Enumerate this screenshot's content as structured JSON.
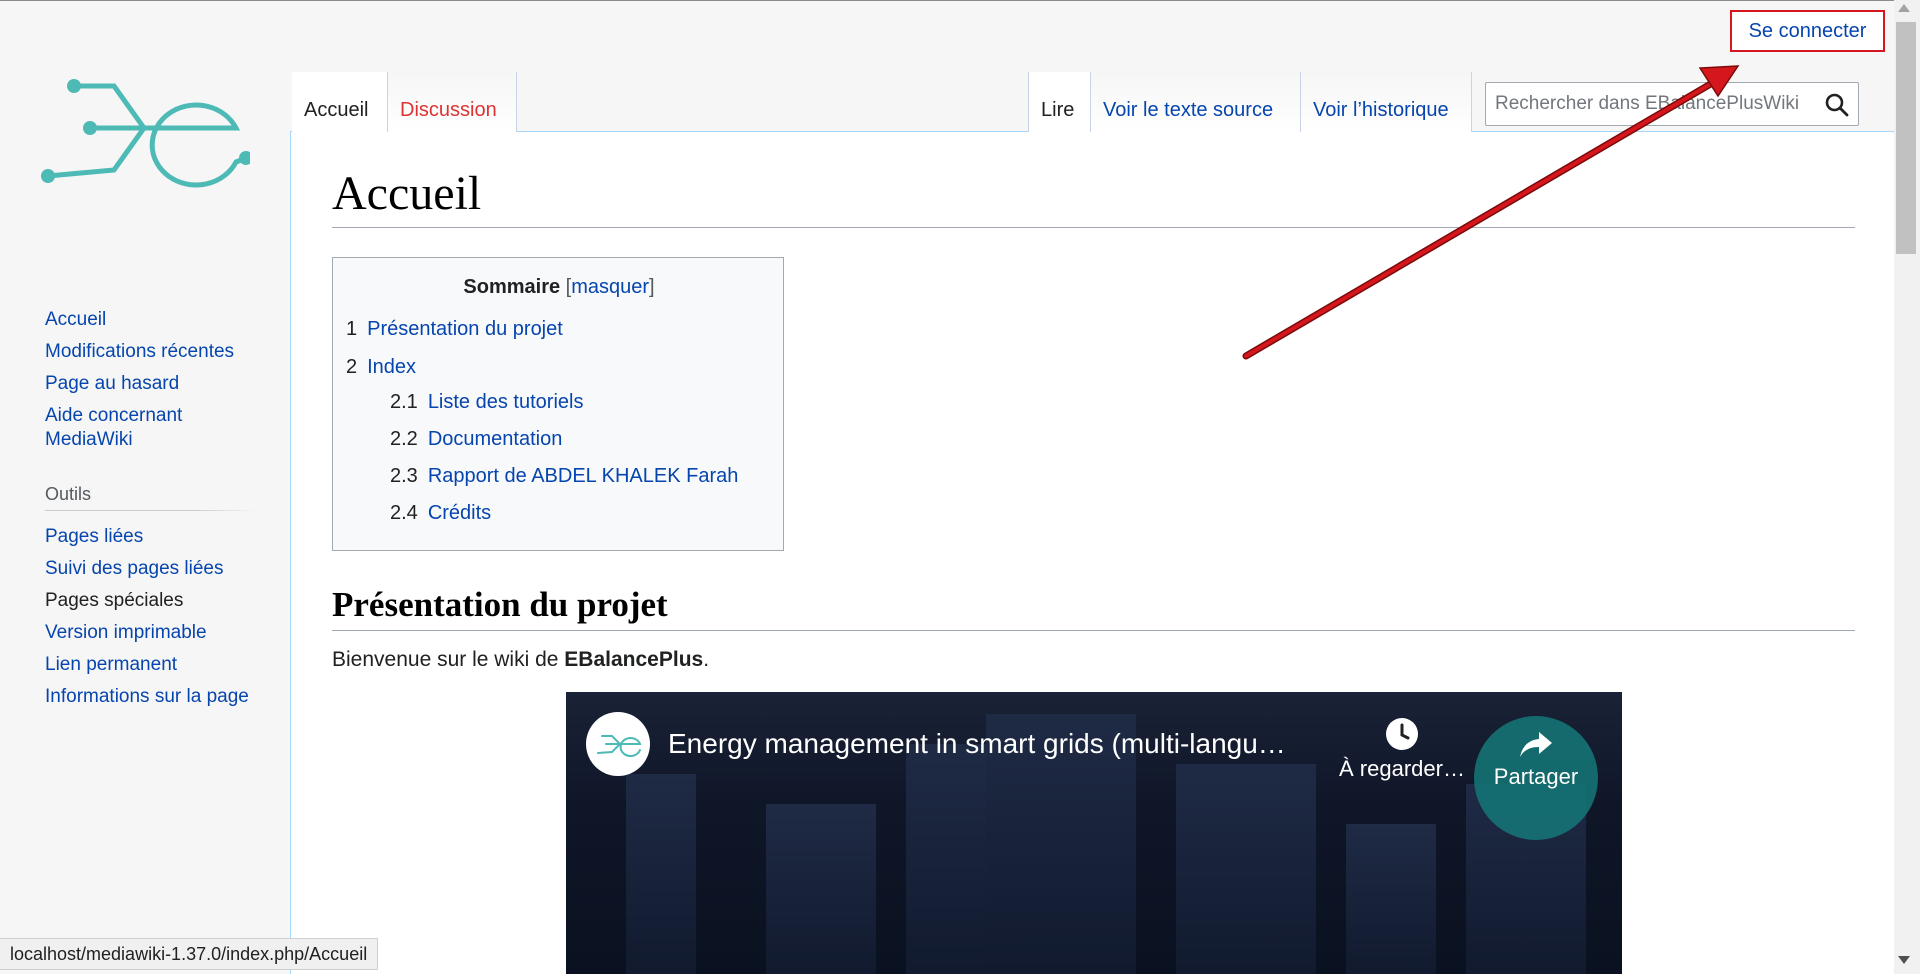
{
  "personal": {
    "login_label": "Se connecter"
  },
  "tabs": {
    "left": [
      {
        "label": "Accueil",
        "selected": true
      },
      {
        "label": "Discussion",
        "selected": false,
        "new": true
      }
    ],
    "right": [
      {
        "label": "Lire",
        "selected": true
      },
      {
        "label": "Voir le texte source",
        "selected": false
      },
      {
        "label": "Voir l’historique",
        "selected": false
      }
    ]
  },
  "search": {
    "placeholder": "Rechercher dans EBalancePlusWiki",
    "icon": "search-icon"
  },
  "sidebar": {
    "nav": [
      {
        "label": "Accueil"
      },
      {
        "label": "Modifications récentes"
      },
      {
        "label": "Page au hasard"
      },
      {
        "label": "Aide concernant MediaWiki"
      }
    ],
    "tools_heading": "Outils",
    "tools": [
      {
        "label": "Pages liées"
      },
      {
        "label": "Suivi des pages liées"
      },
      {
        "label": "Pages spéciales"
      },
      {
        "label": "Version imprimable"
      },
      {
        "label": "Lien permanent"
      },
      {
        "label": "Informations sur la page"
      }
    ]
  },
  "page": {
    "title": "Accueil",
    "toc": {
      "title": "Sommaire",
      "toggle_open": "[",
      "toggle_label": "masquer",
      "toggle_close": "]",
      "items": [
        {
          "num": "1",
          "label": "Présentation du projet"
        },
        {
          "num": "2",
          "label": "Index"
        },
        {
          "num": "2.1",
          "label": "Liste des tutoriels"
        },
        {
          "num": "2.2",
          "label": "Documentation"
        },
        {
          "num": "2.3",
          "label": "Rapport de ABDEL KHALEK Farah"
        },
        {
          "num": "2.4",
          "label": "Crédits"
        }
      ]
    },
    "section_heading": "Présentation du projet",
    "welcome_text": "Bienvenue sur le wiki de ",
    "welcome_bold": "EBalancePlus",
    "welcome_end": "."
  },
  "video": {
    "title": "Energy management in smart grids (multi-langu…",
    "watch_later": "À regarder…",
    "share": "Partager"
  },
  "status_bar": {
    "url": "localhost/mediawiki-1.37.0/index.php/Accueil"
  },
  "colors": {
    "annotation_arrow": "#d5161d",
    "link": "#0645ad",
    "new_link": "#dd3333",
    "logo_teal": "#4dbab5"
  }
}
